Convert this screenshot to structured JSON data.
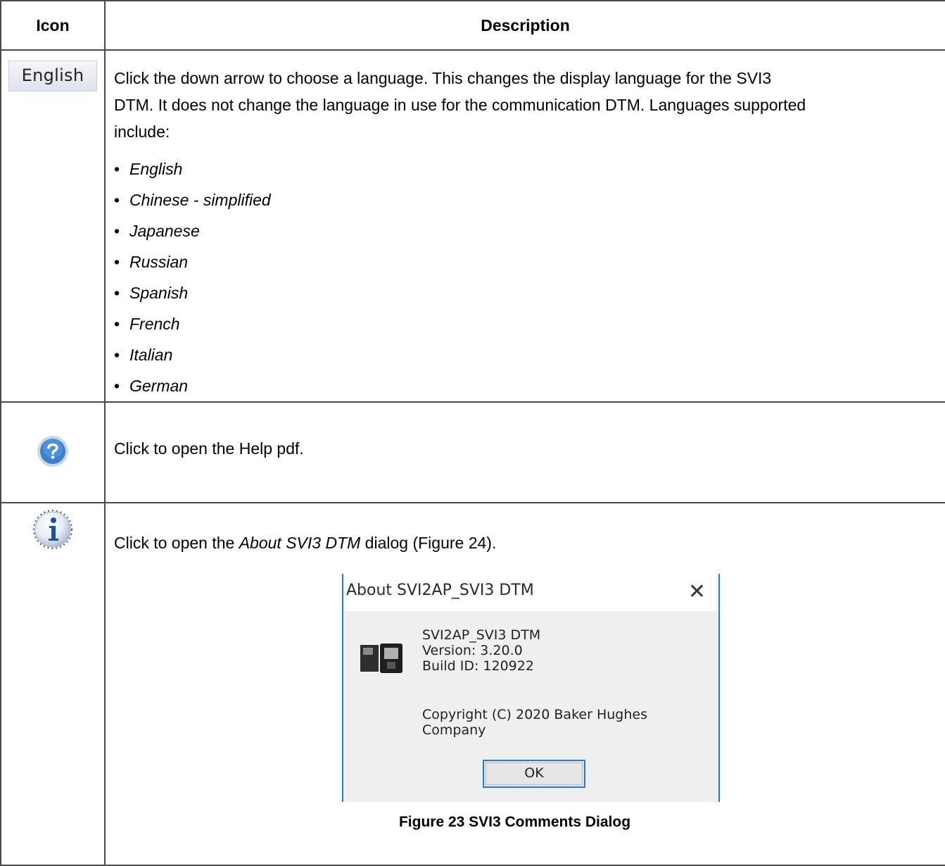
{
  "table": {
    "headers": {
      "icon": "Icon",
      "description": "Description"
    },
    "rows": {
      "language": {
        "icon_text": "English",
        "icon": "language-selector-icon",
        "text_line1": "Click the down arrow to choose a language. This changes the display language for the SVI3",
        "text_line2": "DTM. It does not change the language in use for the communication DTM. Languages supported",
        "text_line3": "include:",
        "languages": [
          "English",
          "Chinese - simplified",
          "Japanese",
          "Russian",
          "Spanish",
          "French",
          "Italian",
          "German"
        ]
      },
      "help": {
        "icon": "help-icon",
        "text": "Click to open the Help pdf."
      },
      "about": {
        "icon": "info-icon",
        "text_before": "Click to open the ",
        "text_em": "About SVI3 DTM",
        "text_after": " dialog (Figure 24).",
        "dialog": {
          "title": "About SVI2AP_SVI3 DTM",
          "close": "✕",
          "product": "SVI2AP_SVI3 DTM",
          "version": "Version: 3.20.0",
          "build": "Build ID: 120922",
          "copyright_line1": "Copyright (C) 2020 Baker Hughes",
          "copyright_line2": "Company",
          "ok_label": "OK"
        },
        "caption": "Figure 23 SVI3 Comments Dialog"
      }
    }
  },
  "colors": {
    "border": "#4a4a4a",
    "dialog_accent": "#2b78d6",
    "dialog_bg": "#f0f0f0",
    "help_blue": "#3a7fd0"
  }
}
